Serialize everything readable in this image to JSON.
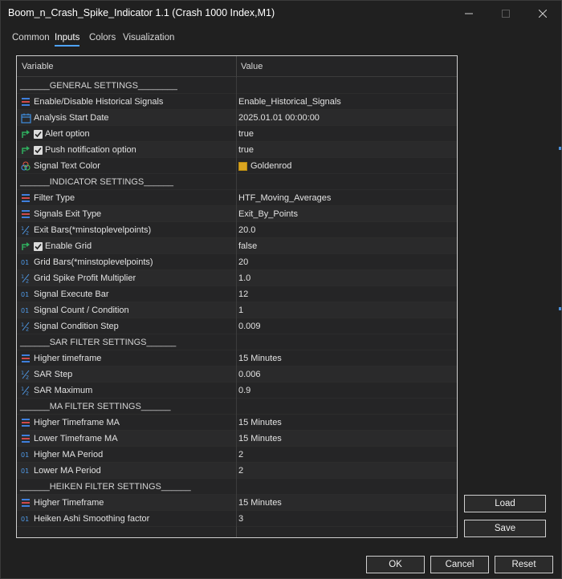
{
  "window": {
    "title": "Boom_n_Crash_Spike_Indicator 1.1 (Crash 1000 Index,M1)"
  },
  "tabs": [
    {
      "label": "Common",
      "active": false
    },
    {
      "label": "Inputs",
      "active": true
    },
    {
      "label": "Colors",
      "active": false
    },
    {
      "label": "Visualization",
      "active": false
    }
  ],
  "grid": {
    "headers": {
      "variable": "Variable",
      "value": "Value"
    },
    "rows": [
      {
        "type": "section",
        "variable": "______GENERAL SETTINGS________",
        "value": ""
      },
      {
        "type": "enum",
        "icon": "enum-icon",
        "variable": "Enable/Disable Historical Signals",
        "value": "Enable_Historical_Signals"
      },
      {
        "type": "date",
        "icon": "calendar-icon",
        "variable": "Analysis Start Date",
        "value": "2025.01.01 00:00:00"
      },
      {
        "type": "bool",
        "icon": "bool-icon",
        "checked": true,
        "variable": "Alert option",
        "value": "true"
      },
      {
        "type": "bool",
        "icon": "bool-icon",
        "checked": true,
        "variable": "Push notification option",
        "value": "true"
      },
      {
        "type": "color",
        "icon": "color-icon",
        "variable": "Signal Text Color",
        "value": "Goldenrod",
        "swatch": "#daa520"
      },
      {
        "type": "section",
        "variable": "______INDICATOR SETTINGS______",
        "value": ""
      },
      {
        "type": "enum",
        "icon": "enum-icon",
        "variable": "Filter Type",
        "value": "HTF_Moving_Averages"
      },
      {
        "type": "enum",
        "icon": "enum-icon",
        "variable": "Signals Exit  Type",
        "value": "Exit_By_Points"
      },
      {
        "type": "double",
        "icon": "double-icon",
        "variable": "Exit Bars(*minstoplevelpoints)",
        "value": "20.0"
      },
      {
        "type": "bool",
        "icon": "bool-icon",
        "checked": true,
        "variable": "Enable Grid",
        "value": "false"
      },
      {
        "type": "int",
        "icon": "int-icon",
        "variable": "Grid Bars(*minstoplevelpoints)",
        "value": "20"
      },
      {
        "type": "double",
        "icon": "double-icon",
        "variable": "Grid Spike Profit Multiplier",
        "value": "1.0"
      },
      {
        "type": "int",
        "icon": "int-icon",
        "variable": "Signal Execute Bar",
        "value": "12"
      },
      {
        "type": "int",
        "icon": "int-icon",
        "variable": "Signal Count / Condition",
        "value": "1"
      },
      {
        "type": "double",
        "icon": "double-icon",
        "variable": "Signal Condition Step",
        "value": "0.009"
      },
      {
        "type": "section",
        "variable": "______SAR FILTER SETTINGS______",
        "value": ""
      },
      {
        "type": "enum",
        "icon": "enum-icon",
        "variable": "Higher timeframe",
        "value": "15 Minutes"
      },
      {
        "type": "double",
        "icon": "double-icon",
        "variable": "SAR Step",
        "value": "0.006"
      },
      {
        "type": "double",
        "icon": "double-icon",
        "variable": "SAR Maximum",
        "value": "0.9"
      },
      {
        "type": "section",
        "variable": "______MA FILTER SETTINGS______",
        "value": ""
      },
      {
        "type": "enum",
        "icon": "enum-icon",
        "variable": "Higher Timeframe MA",
        "value": "15 Minutes"
      },
      {
        "type": "enum",
        "icon": "enum-icon",
        "variable": "Lower  Timeframe MA",
        "value": "15 Minutes"
      },
      {
        "type": "int",
        "icon": "int-icon",
        "variable": "Higher MA Period",
        "value": "2"
      },
      {
        "type": "int",
        "icon": "int-icon",
        "variable": "Lower MA Period",
        "value": "2"
      },
      {
        "type": "section",
        "variable": "______HEIKEN FILTER SETTINGS______",
        "value": ""
      },
      {
        "type": "enum",
        "icon": "enum-icon",
        "variable": "Higher Timeframe",
        "value": "15 Minutes"
      },
      {
        "type": "int",
        "icon": "int-icon",
        "variable": "Heiken Ashi Smoothing factor",
        "value": "3"
      }
    ]
  },
  "side_buttons": {
    "load": "Load",
    "save": "Save"
  },
  "footer_buttons": {
    "ok": "OK",
    "cancel": "Cancel",
    "reset": "Reset"
  }
}
